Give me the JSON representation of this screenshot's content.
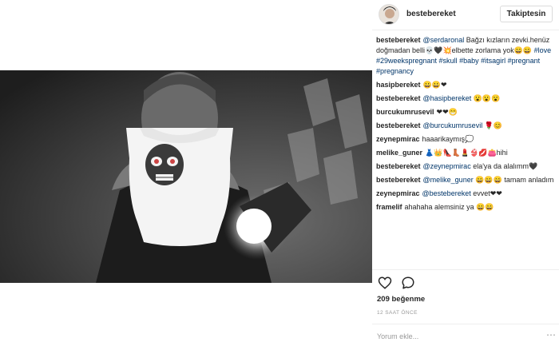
{
  "post": {
    "image_alt": "photo"
  },
  "header": {
    "username": "bestebereket",
    "follow_label": "Takiptesin"
  },
  "comments": [
    {
      "user": "bestebereket",
      "parts": [
        {
          "t": "@serdaronal",
          "blue": true
        },
        {
          "t": " Bağzı kızların zevki.henüz doğmadan belli💀🖤💥elbette zorlama yok😄😄 ",
          "blue": false
        },
        {
          "t": "#love #29weekspregnant #skull #baby #itsagirl #pregnant #pregnancy",
          "blue": true
        }
      ]
    },
    {
      "user": "hasipbereket",
      "parts": [
        {
          "t": "😀😀❤",
          "blue": false
        }
      ]
    },
    {
      "user": "bestebereket",
      "parts": [
        {
          "t": "@hasipbereket",
          "blue": true
        },
        {
          "t": " 😮😮😮",
          "blue": false
        }
      ]
    },
    {
      "user": "burcukumrusevil",
      "parts": [
        {
          "t": "❤❤😁",
          "blue": false
        }
      ]
    },
    {
      "user": "bestebereket",
      "parts": [
        {
          "t": "@burcukumrusevil",
          "blue": true
        },
        {
          "t": " 🌹😊",
          "blue": false
        }
      ]
    },
    {
      "user": "zeynepmirac",
      "parts": [
        {
          "t": "haaarikaymış💭",
          "blue": false
        }
      ]
    },
    {
      "user": "melike_guner",
      "parts": [
        {
          "t": "👗👑👠👢💄👙💋👛hihi",
          "blue": false
        }
      ]
    },
    {
      "user": "bestebereket",
      "parts": [
        {
          "t": "@zeynepmirac",
          "blue": true
        },
        {
          "t": " ela'ya da alalımm🖤",
          "blue": false
        }
      ]
    },
    {
      "user": "bestebereket",
      "parts": [
        {
          "t": "@melike_guner",
          "blue": true
        },
        {
          "t": " 😄😄😄 tamam anladım",
          "blue": false
        }
      ]
    },
    {
      "user": "zeynepmirac",
      "parts": [
        {
          "t": "@bestebereket",
          "blue": true
        },
        {
          "t": " evvet❤❤",
          "blue": false
        }
      ]
    },
    {
      "user": "framelif",
      "parts": [
        {
          "t": "ahahaha alemsiniz ya 😄😄",
          "blue": false
        }
      ]
    }
  ],
  "actions": {
    "like_icon": "heart-outline",
    "comment_icon": "speech-bubble-outline",
    "likes_text": "209 beğenme",
    "time_text": "12 SAAT ÖNCE",
    "comment_placeholder": "Yorum ekle...",
    "more_label": "⋯"
  }
}
